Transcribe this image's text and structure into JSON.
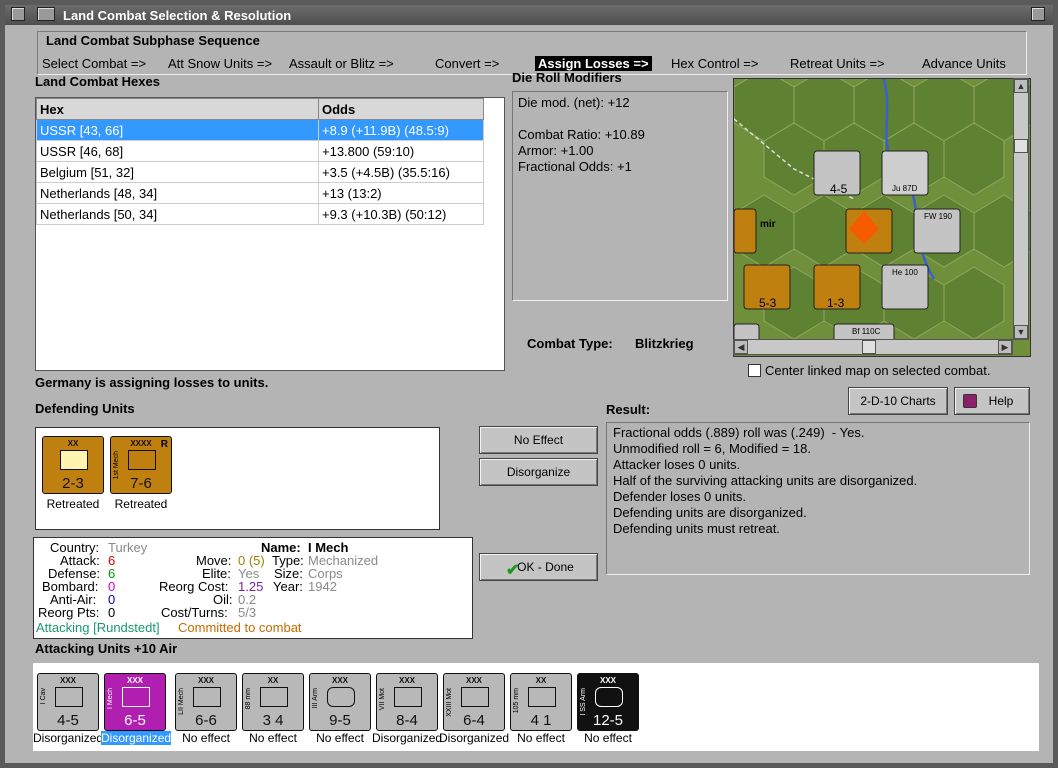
{
  "window": {
    "title": "Land Combat Selection & Resolution"
  },
  "sequence": {
    "title": "Land Combat Subphase Sequence",
    "items": [
      "Select Combat =>",
      "Att Snow Units =>",
      "Assault or Blitz =>",
      "Convert =>",
      "Assign Losses =>",
      "Hex Control =>",
      "Retreat Units =>",
      "Advance Units"
    ],
    "active_index": 4
  },
  "hexes": {
    "title": "Land Combat Hexes",
    "columns": [
      "Hex",
      "Odds"
    ],
    "rows": [
      {
        "hex": "USSR [43, 66]",
        "odds": "+8.9 (+11.9B) (48.5:9)",
        "selected": true
      },
      {
        "hex": "USSR [46, 68]",
        "odds": "+13.800 (59:10)",
        "selected": false
      },
      {
        "hex": "Belgium [51, 32]",
        "odds": "+3.5 (+4.5B) (35.5:16)",
        "selected": false
      },
      {
        "hex": "Netherlands [48, 34]",
        "odds": "+13 (13:2)",
        "selected": false
      },
      {
        "hex": "Netherlands [50, 34]",
        "odds": "+9.3 (+10.3B) (50:12)",
        "selected": false
      }
    ]
  },
  "die_roll": {
    "title": "Die Roll Modifiers",
    "lines": [
      "Die mod. (net): +12",
      "",
      "Combat Ratio: +10.89",
      "Armor: +1.00",
      "Fractional Odds: +1"
    ]
  },
  "combat_type": {
    "label": "Combat Type:",
    "value": "Blitzkrieg"
  },
  "center_map": {
    "label": "Center linked map on selected combat.",
    "checked": false
  },
  "buttons": {
    "charts": "2-D-10 Charts",
    "help": "Help",
    "no_effect": "No Effect",
    "disorganize": "Disorganize",
    "ok": "OK - Done"
  },
  "status_message": "Germany is assigning losses to units.",
  "defending": {
    "title": "Defending Units",
    "units": [
      {
        "corps": "XX",
        "value": "2-3",
        "status": "Retreated",
        "side": "",
        "reorg": ""
      },
      {
        "corps": "XXXX",
        "value": "7-6",
        "status": "Retreated",
        "side": "1st Mech",
        "reorg": "R"
      }
    ]
  },
  "result": {
    "title": "Result:",
    "lines": [
      "Fractional odds (.889) roll was (.249)  - Yes.",
      "Unmodified roll = 6, Modified = 18.",
      "Attacker loses 0 units.",
      "Half of the surviving attacking units are disorganized.",
      "Defender loses 0 units.",
      "Defending units are disorganized.",
      "Defending units must retreat."
    ]
  },
  "unit_info": {
    "country_label": "Country:",
    "country": "Turkey",
    "attack_label": "Attack:",
    "attack": "6",
    "defense_label": "Defense:",
    "defense": "6",
    "bombard_label": "Bombard:",
    "bombard": "0",
    "antiair_label": "Anti-Air:",
    "antiair": "0",
    "reorg_label": "Reorg Pts:",
    "reorg": "0",
    "name_label": "Name:",
    "name": "I Mech",
    "move_label": "Move:",
    "move": "0 (5)",
    "type_label": "Type:",
    "type": "Mechanized",
    "elite_label": "Elite:",
    "elite": "Yes",
    "size_label": "Size:",
    "size": "Corps",
    "reorg_cost_label": "Reorg Cost:",
    "reorg_cost": "1.25",
    "year_label": "Year:",
    "year": "1942",
    "oil_label": "Oil:",
    "oil": "0.2",
    "cost_label": "Cost/Turns:",
    "cost": "5/3",
    "attacking": "Attacking [Rundstedt]",
    "committed": "Committed to combat"
  },
  "attacking": {
    "title": "Attacking Units +10 Air",
    "units": [
      {
        "corps": "XXX",
        "side": "I Cav",
        "value": "4-5",
        "status": "Disorganized",
        "selected": false,
        "bg": "#b8b8b8"
      },
      {
        "corps": "XXX",
        "side": "I Mech",
        "value": "6-5",
        "status": "Disorganized",
        "selected": true,
        "bg": "#b01fb0"
      },
      {
        "corps": "XXX",
        "side": "LII Mech",
        "value": "6-6",
        "status": "No effect",
        "selected": false,
        "bg": "#b8b8b8"
      },
      {
        "corps": "XX",
        "side": "88 mm",
        "value": "3 4",
        "status": "No effect",
        "selected": false,
        "bg": "#b8b8b8"
      },
      {
        "corps": "XXX",
        "side": "III Arm",
        "value": "9-5",
        "status": "No effect",
        "selected": false,
        "bg": "#b8b8b8"
      },
      {
        "corps": "XXX",
        "side": "VII Mot",
        "value": "8-4",
        "status": "Disorganized",
        "selected": false,
        "bg": "#b8b8b8"
      },
      {
        "corps": "XXX",
        "side": "XXIII Mot",
        "value": "6-4",
        "status": "Disorganized",
        "selected": false,
        "bg": "#b8b8b8"
      },
      {
        "corps": "XX",
        "side": "105 mm",
        "value": "4 1",
        "status": "No effect",
        "selected": false,
        "bg": "#b8b8b8"
      },
      {
        "corps": "XXX",
        "side": "I SS Arm",
        "value": "12-5",
        "status": "No effect",
        "selected": false,
        "bg": "#111111"
      }
    ]
  },
  "map_labels": {
    "l1": "4-5",
    "l2": "5-3",
    "l3": "1-3",
    "l4": "Ju 87D",
    "l5": "FW 190",
    "l6": "He 100",
    "l7": "Bf 110C",
    "l8": "mir"
  }
}
